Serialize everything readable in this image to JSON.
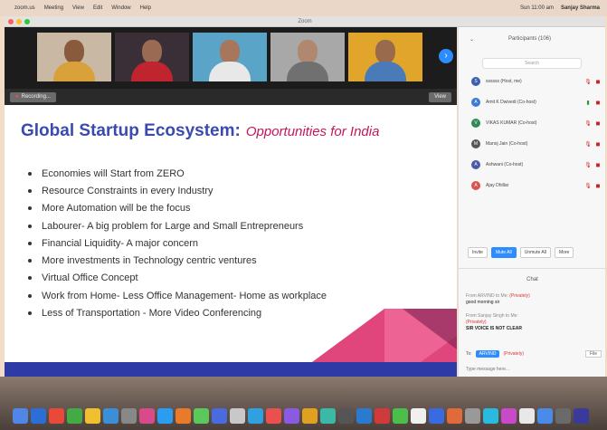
{
  "menubar": {
    "app": "zoom.us",
    "items": [
      "Meeting",
      "View",
      "Edit",
      "Window",
      "Help"
    ],
    "clock": "Sun 11:00 am",
    "user": "Sanjay Sharma"
  },
  "window": {
    "title": "Zoom"
  },
  "video_strip": {
    "tiles": [
      {
        "bg": "#c9b8a4",
        "skin": "#8a5a3c",
        "shirt": "#d8a13a"
      },
      {
        "bg": "#3a2f36",
        "skin": "#9a6a52",
        "shirt": "#c0242f"
      },
      {
        "bg": "#5aa4c8",
        "skin": "#a8765a",
        "shirt": "#e8e8e8"
      },
      {
        "bg": "#a8a8a8",
        "skin": "#b08870",
        "shirt": "#707070"
      },
      {
        "bg": "#e2a52c",
        "skin": "#9a6a4c",
        "shirt": "#4a7ab8"
      }
    ],
    "next_icon": "›"
  },
  "stage": {
    "recording_label": "Recording...",
    "view_label": "View"
  },
  "slide": {
    "title_main": "Global Startup Ecosystem:",
    "title_sub": "Opportunities for India",
    "bullets": [
      "Economies will Start from ZERO",
      "Resource Constraints in every Industry",
      "More Automation will be the focus",
      "Labourer- A big problem for Large and Small Entrepreneurs",
      "Financial Liquidity- A major concern",
      "More investments in Technology centric ventures",
      "Virtual Office Concept",
      "Work from Home- Less Office Management- Home as workplace",
      "Less of Transportation - More Video Conferencing"
    ]
  },
  "panel": {
    "title": "Participants (106)",
    "search_placeholder": "Search",
    "participants": [
      {
        "initial": "S",
        "color": "#3a5fb0",
        "name": "ssssss (Host, me)"
      },
      {
        "initial": "A",
        "color": "#3a7bd5",
        "name": "Amit K Dwivedi (Co-host)"
      },
      {
        "initial": "V",
        "color": "#2e8b57",
        "name": "VIKAS KUMAR (Co-host)"
      },
      {
        "initial": "M",
        "color": "#555555",
        "name": "Manoj Jain (Co-host)"
      },
      {
        "initial": "A",
        "color": "#4a5aa8",
        "name": "Ashwani (Co-host)"
      },
      {
        "initial": "A",
        "color": "#d9534f",
        "name": "Ajay Dhillar"
      }
    ],
    "buttons": [
      "Invite",
      "Mute All",
      "Unmute All",
      "More"
    ],
    "chat": {
      "header": "Chat",
      "messages": [
        {
          "from": "From ARVIND to Me:",
          "priv": "(Privately)",
          "text": "good morning sir"
        },
        {
          "from": "From Sanjay Singh to Me:",
          "priv": "(Privately)",
          "text": "SIR VOICE IS NOT CLEAR"
        }
      ],
      "to_label": "To:",
      "to_value": "ARVIND",
      "to_priv": "(Privately)",
      "file_label": "File",
      "input_placeholder": "Type message here..."
    }
  },
  "dock": {
    "colors": [
      "#4f86e8",
      "#2b6fd6",
      "#e84a3a",
      "#44aa44",
      "#f0c030",
      "#3a8fd8",
      "#888888",
      "#d84a8a",
      "#2c9cf0",
      "#e87a2a",
      "#5ac85a",
      "#4a6ae0",
      "#c8c8c8",
      "#30a0e0",
      "#ea5050",
      "#8a5ae0",
      "#e0a020",
      "#3ab8a8",
      "#555555",
      "#2a7ad0",
      "#d03a3a",
      "#4ac04a",
      "#f0f0f0",
      "#3a6ae0",
      "#e06a3a",
      "#999999",
      "#2abadf",
      "#c84ac8",
      "#e8e8e8",
      "#4a8ae8",
      "#6a6a6a",
      "#3a3a9a"
    ]
  }
}
